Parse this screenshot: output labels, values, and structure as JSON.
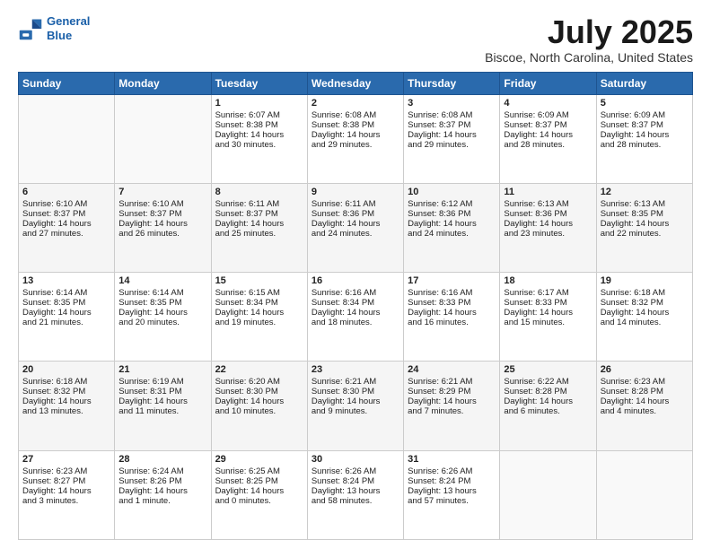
{
  "header": {
    "logo_line1": "General",
    "logo_line2": "Blue",
    "title": "July 2025",
    "subtitle": "Biscoe, North Carolina, United States"
  },
  "days_of_week": [
    "Sunday",
    "Monday",
    "Tuesday",
    "Wednesday",
    "Thursday",
    "Friday",
    "Saturday"
  ],
  "weeks": [
    [
      {
        "day": "",
        "lines": []
      },
      {
        "day": "",
        "lines": []
      },
      {
        "day": "1",
        "lines": [
          "Sunrise: 6:07 AM",
          "Sunset: 8:38 PM",
          "Daylight: 14 hours",
          "and 30 minutes."
        ]
      },
      {
        "day": "2",
        "lines": [
          "Sunrise: 6:08 AM",
          "Sunset: 8:38 PM",
          "Daylight: 14 hours",
          "and 29 minutes."
        ]
      },
      {
        "day": "3",
        "lines": [
          "Sunrise: 6:08 AM",
          "Sunset: 8:37 PM",
          "Daylight: 14 hours",
          "and 29 minutes."
        ]
      },
      {
        "day": "4",
        "lines": [
          "Sunrise: 6:09 AM",
          "Sunset: 8:37 PM",
          "Daylight: 14 hours",
          "and 28 minutes."
        ]
      },
      {
        "day": "5",
        "lines": [
          "Sunrise: 6:09 AM",
          "Sunset: 8:37 PM",
          "Daylight: 14 hours",
          "and 28 minutes."
        ]
      }
    ],
    [
      {
        "day": "6",
        "lines": [
          "Sunrise: 6:10 AM",
          "Sunset: 8:37 PM",
          "Daylight: 14 hours",
          "and 27 minutes."
        ]
      },
      {
        "day": "7",
        "lines": [
          "Sunrise: 6:10 AM",
          "Sunset: 8:37 PM",
          "Daylight: 14 hours",
          "and 26 minutes."
        ]
      },
      {
        "day": "8",
        "lines": [
          "Sunrise: 6:11 AM",
          "Sunset: 8:37 PM",
          "Daylight: 14 hours",
          "and 25 minutes."
        ]
      },
      {
        "day": "9",
        "lines": [
          "Sunrise: 6:11 AM",
          "Sunset: 8:36 PM",
          "Daylight: 14 hours",
          "and 24 minutes."
        ]
      },
      {
        "day": "10",
        "lines": [
          "Sunrise: 6:12 AM",
          "Sunset: 8:36 PM",
          "Daylight: 14 hours",
          "and 24 minutes."
        ]
      },
      {
        "day": "11",
        "lines": [
          "Sunrise: 6:13 AM",
          "Sunset: 8:36 PM",
          "Daylight: 14 hours",
          "and 23 minutes."
        ]
      },
      {
        "day": "12",
        "lines": [
          "Sunrise: 6:13 AM",
          "Sunset: 8:35 PM",
          "Daylight: 14 hours",
          "and 22 minutes."
        ]
      }
    ],
    [
      {
        "day": "13",
        "lines": [
          "Sunrise: 6:14 AM",
          "Sunset: 8:35 PM",
          "Daylight: 14 hours",
          "and 21 minutes."
        ]
      },
      {
        "day": "14",
        "lines": [
          "Sunrise: 6:14 AM",
          "Sunset: 8:35 PM",
          "Daylight: 14 hours",
          "and 20 minutes."
        ]
      },
      {
        "day": "15",
        "lines": [
          "Sunrise: 6:15 AM",
          "Sunset: 8:34 PM",
          "Daylight: 14 hours",
          "and 19 minutes."
        ]
      },
      {
        "day": "16",
        "lines": [
          "Sunrise: 6:16 AM",
          "Sunset: 8:34 PM",
          "Daylight: 14 hours",
          "and 18 minutes."
        ]
      },
      {
        "day": "17",
        "lines": [
          "Sunrise: 6:16 AM",
          "Sunset: 8:33 PM",
          "Daylight: 14 hours",
          "and 16 minutes."
        ]
      },
      {
        "day": "18",
        "lines": [
          "Sunrise: 6:17 AM",
          "Sunset: 8:33 PM",
          "Daylight: 14 hours",
          "and 15 minutes."
        ]
      },
      {
        "day": "19",
        "lines": [
          "Sunrise: 6:18 AM",
          "Sunset: 8:32 PM",
          "Daylight: 14 hours",
          "and 14 minutes."
        ]
      }
    ],
    [
      {
        "day": "20",
        "lines": [
          "Sunrise: 6:18 AM",
          "Sunset: 8:32 PM",
          "Daylight: 14 hours",
          "and 13 minutes."
        ]
      },
      {
        "day": "21",
        "lines": [
          "Sunrise: 6:19 AM",
          "Sunset: 8:31 PM",
          "Daylight: 14 hours",
          "and 11 minutes."
        ]
      },
      {
        "day": "22",
        "lines": [
          "Sunrise: 6:20 AM",
          "Sunset: 8:30 PM",
          "Daylight: 14 hours",
          "and 10 minutes."
        ]
      },
      {
        "day": "23",
        "lines": [
          "Sunrise: 6:21 AM",
          "Sunset: 8:30 PM",
          "Daylight: 14 hours",
          "and 9 minutes."
        ]
      },
      {
        "day": "24",
        "lines": [
          "Sunrise: 6:21 AM",
          "Sunset: 8:29 PM",
          "Daylight: 14 hours",
          "and 7 minutes."
        ]
      },
      {
        "day": "25",
        "lines": [
          "Sunrise: 6:22 AM",
          "Sunset: 8:28 PM",
          "Daylight: 14 hours",
          "and 6 minutes."
        ]
      },
      {
        "day": "26",
        "lines": [
          "Sunrise: 6:23 AM",
          "Sunset: 8:28 PM",
          "Daylight: 14 hours",
          "and 4 minutes."
        ]
      }
    ],
    [
      {
        "day": "27",
        "lines": [
          "Sunrise: 6:23 AM",
          "Sunset: 8:27 PM",
          "Daylight: 14 hours",
          "and 3 minutes."
        ]
      },
      {
        "day": "28",
        "lines": [
          "Sunrise: 6:24 AM",
          "Sunset: 8:26 PM",
          "Daylight: 14 hours",
          "and 1 minute."
        ]
      },
      {
        "day": "29",
        "lines": [
          "Sunrise: 6:25 AM",
          "Sunset: 8:25 PM",
          "Daylight: 14 hours",
          "and 0 minutes."
        ]
      },
      {
        "day": "30",
        "lines": [
          "Sunrise: 6:26 AM",
          "Sunset: 8:24 PM",
          "Daylight: 13 hours",
          "and 58 minutes."
        ]
      },
      {
        "day": "31",
        "lines": [
          "Sunrise: 6:26 AM",
          "Sunset: 8:24 PM",
          "Daylight: 13 hours",
          "and 57 minutes."
        ]
      },
      {
        "day": "",
        "lines": []
      },
      {
        "day": "",
        "lines": []
      }
    ]
  ]
}
